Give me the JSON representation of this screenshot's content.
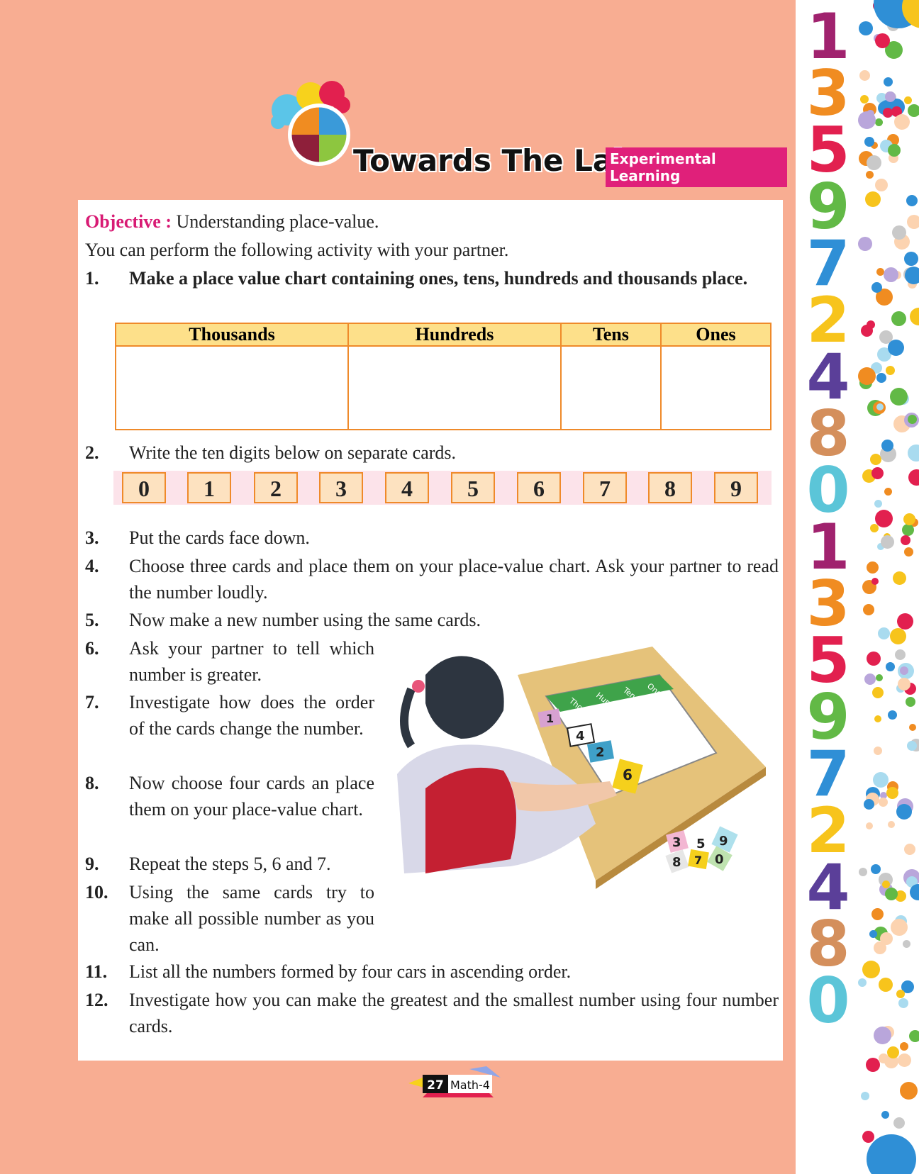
{
  "header": {
    "title": "Towards The Lab",
    "badge": "Experimental Learning"
  },
  "objective": {
    "label": "Objective :",
    "text": "Understanding place-value."
  },
  "intro": "You can perform the following activity with your partner.",
  "steps": [
    {
      "num": "1.",
      "text": "Make a place value chart containing ones, tens, hundreds and thousands place."
    },
    {
      "num": "2.",
      "text": "Write the ten digits below on separate cards."
    },
    {
      "num": "3.",
      "text": "Put the cards face down."
    },
    {
      "num": "4.",
      "text": "Choose three cards and place them on your place-value chart. Ask your partner to read the number loudly."
    },
    {
      "num": "5.",
      "text": "Now make a new number using the same cards."
    },
    {
      "num": "6.",
      "text": "Ask your partner to tell which number is greater."
    },
    {
      "num": "7.",
      "text": "Investigate how does the order of the cards change the number."
    },
    {
      "num": "8.",
      "text": "Now choose four cards an place them on your place-value chart."
    },
    {
      "num": "9.",
      "text": "Repeat the steps 5, 6 and 7."
    },
    {
      "num": "10.",
      "text": "Using the same cards try to make all possible number as you can."
    },
    {
      "num": "11.",
      "text": "List all the numbers formed by four cars in ascending order."
    },
    {
      "num": "12.",
      "text": "Investigate how you can make the greatest and the smallest number using four number cards."
    }
  ],
  "place_value_chart": {
    "headers": [
      "Thousands",
      "Hundreds",
      "Tens",
      "Ones"
    ]
  },
  "digit_cards": [
    "0",
    "1",
    "2",
    "3",
    "4",
    "5",
    "6",
    "7",
    "8",
    "9"
  ],
  "illustration": {
    "chart_labels": [
      "Thousands",
      "Hundreds",
      "Tens",
      "Ones"
    ],
    "cards_on_chart": [
      "1",
      "4",
      "2",
      "6"
    ],
    "loose_cards": [
      "3",
      "5",
      "9",
      "8",
      "7",
      "0"
    ]
  },
  "sidebar_digits": [
    "1",
    "3",
    "5",
    "9",
    "7",
    "2",
    "4",
    "8",
    "0",
    "1",
    "3",
    "5",
    "9",
    "7",
    "2",
    "4",
    "8",
    "0"
  ],
  "footer": {
    "page": "27",
    "book": "Math-4"
  },
  "colors": {
    "page_bg": "#f8ad92",
    "accent_pink": "#d81b74",
    "table_header": "#fde08a",
    "table_border": "#ef8a2a"
  }
}
